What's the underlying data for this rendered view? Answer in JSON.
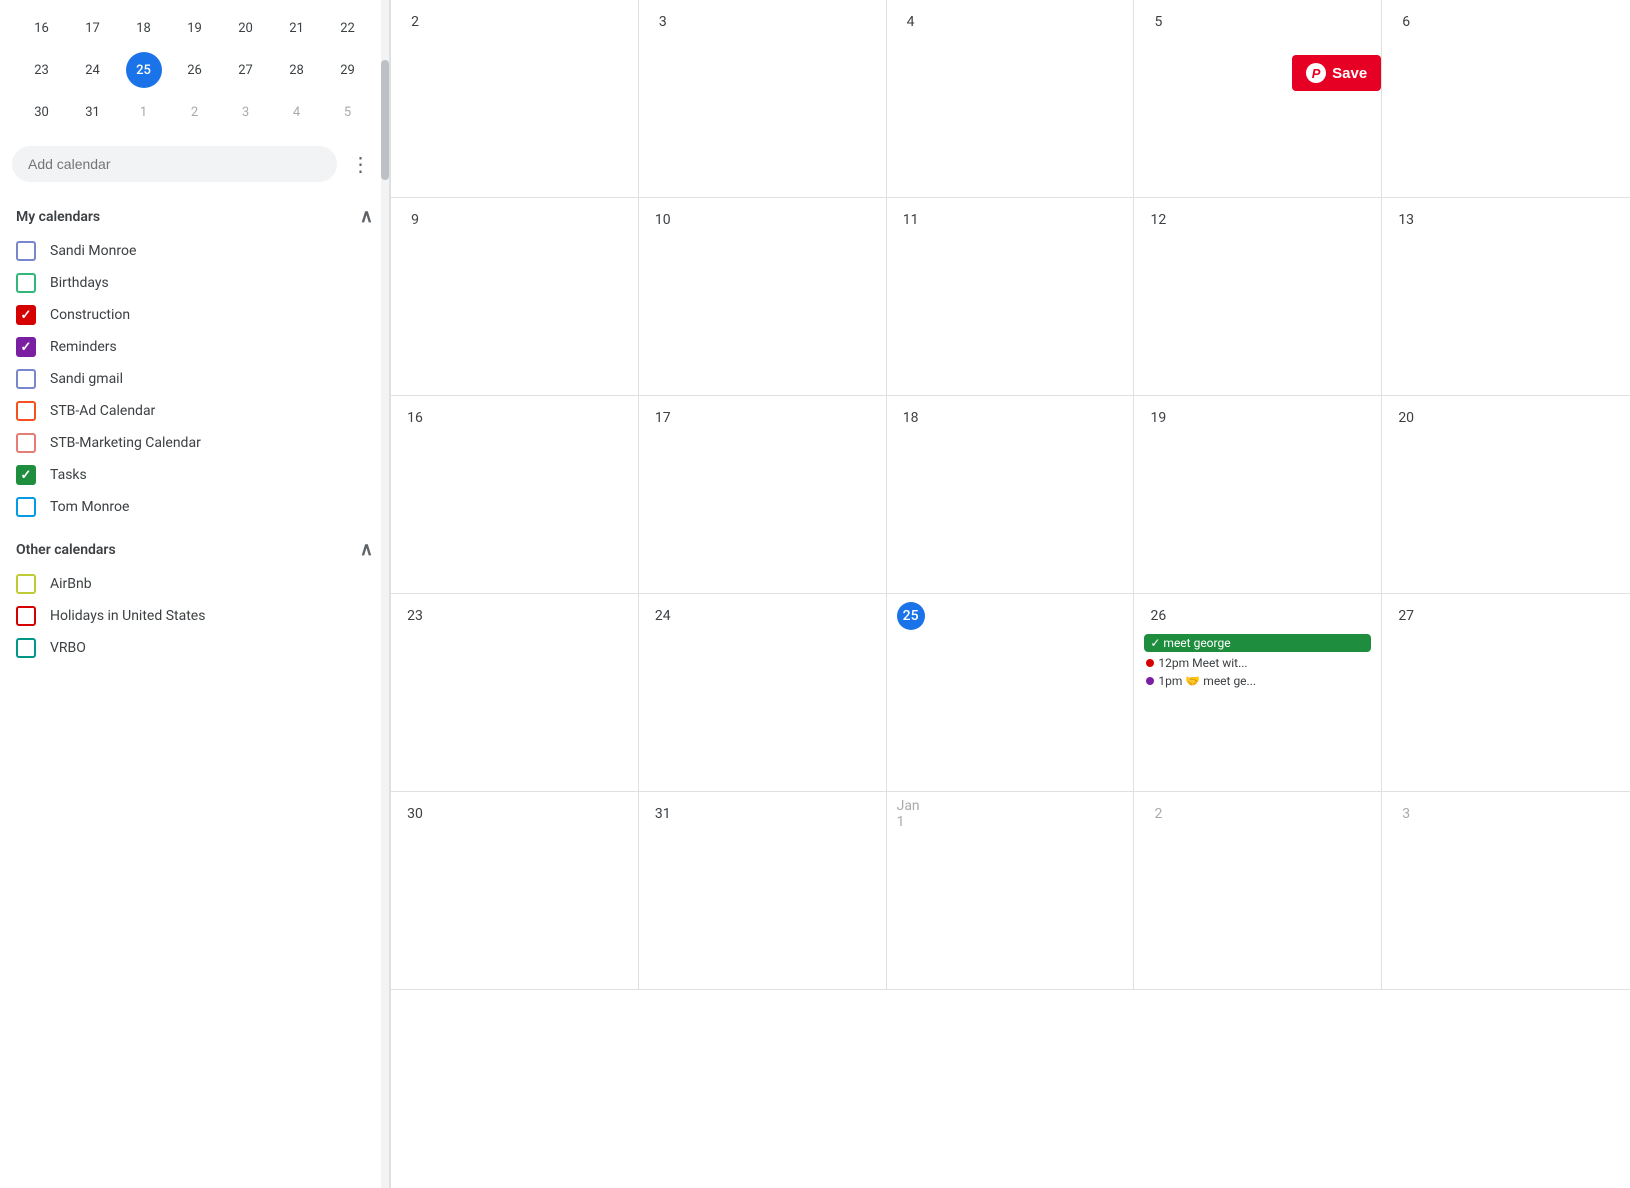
{
  "sidebar": {
    "mini_cal": {
      "rows": [
        [
          {
            "label": "16",
            "type": "normal"
          },
          {
            "label": "17",
            "type": "normal"
          },
          {
            "label": "18",
            "type": "normal"
          },
          {
            "label": "19",
            "type": "normal"
          },
          {
            "label": "20",
            "type": "normal"
          },
          {
            "label": "21",
            "type": "normal"
          },
          {
            "label": "22",
            "type": "normal"
          }
        ],
        [
          {
            "label": "23",
            "type": "normal"
          },
          {
            "label": "24",
            "type": "normal"
          },
          {
            "label": "25",
            "type": "today"
          },
          {
            "label": "26",
            "type": "normal"
          },
          {
            "label": "27",
            "type": "normal"
          },
          {
            "label": "28",
            "type": "normal"
          },
          {
            "label": "29",
            "type": "normal"
          }
        ],
        [
          {
            "label": "30",
            "type": "normal"
          },
          {
            "label": "31",
            "type": "normal"
          },
          {
            "label": "1",
            "type": "other-month"
          },
          {
            "label": "2",
            "type": "other-month"
          },
          {
            "label": "3",
            "type": "other-month"
          },
          {
            "label": "4",
            "type": "other-month"
          },
          {
            "label": "5",
            "type": "other-month"
          }
        ]
      ]
    },
    "add_calendar_placeholder": "Add calendar",
    "my_calendars_label": "My calendars",
    "other_calendars_label": "Other calendars",
    "my_calendars": [
      {
        "label": "Sandi Monroe",
        "color": "#7986cb",
        "checked": false
      },
      {
        "label": "Birthdays",
        "color": "#33b679",
        "checked": false
      },
      {
        "label": "Construction",
        "color": "#d50000",
        "checked": true
      },
      {
        "label": "Reminders",
        "color": "#7b1fa2",
        "checked": true
      },
      {
        "label": "Sandi gmail",
        "color": "#7986cb",
        "checked": false
      },
      {
        "label": "STB-Ad Calendar",
        "color": "#f4511e",
        "checked": false
      },
      {
        "label": "STB-Marketing Calendar",
        "color": "#e67c73",
        "checked": false
      },
      {
        "label": "Tasks",
        "color": "#1e8e3e",
        "checked": true
      },
      {
        "label": "Tom Monroe",
        "color": "#039be5",
        "checked": false
      }
    ],
    "other_calendars": [
      {
        "label": "AirBnb",
        "color": "#c0ca33",
        "checked": false
      },
      {
        "label": "Holidays in United States",
        "color": "#d50000",
        "checked": false
      },
      {
        "label": "VRBO",
        "color": "#009688",
        "checked": false
      }
    ]
  },
  "calendar": {
    "weeks": [
      {
        "days": [
          {
            "number": "2",
            "type": "normal",
            "events": []
          },
          {
            "number": "3",
            "type": "normal",
            "events": []
          },
          {
            "number": "4",
            "type": "normal",
            "events": []
          },
          {
            "number": "5",
            "type": "normal",
            "events": [],
            "has_pinterest": true
          },
          {
            "number": "6",
            "type": "normal",
            "events": []
          }
        ]
      },
      {
        "days": [
          {
            "number": "9",
            "type": "normal",
            "events": []
          },
          {
            "number": "10",
            "type": "normal",
            "events": []
          },
          {
            "number": "11",
            "type": "normal",
            "events": []
          },
          {
            "number": "12",
            "type": "normal",
            "events": []
          },
          {
            "number": "13",
            "type": "normal",
            "events": []
          }
        ]
      },
      {
        "days": [
          {
            "number": "16",
            "type": "normal",
            "events": []
          },
          {
            "number": "17",
            "type": "normal",
            "events": []
          },
          {
            "number": "18",
            "type": "normal",
            "events": []
          },
          {
            "number": "19",
            "type": "normal",
            "events": []
          },
          {
            "number": "20",
            "type": "normal",
            "events": []
          }
        ]
      },
      {
        "days": [
          {
            "number": "23",
            "type": "normal",
            "events": []
          },
          {
            "number": "24",
            "type": "normal",
            "events": []
          },
          {
            "number": "25",
            "type": "today",
            "events": []
          },
          {
            "number": "26",
            "type": "normal",
            "events": [
              {
                "type": "chip",
                "color": "#1e8e3e",
                "bg": "#1e8e3e",
                "text": "✓ meet george",
                "text_color": "#fff"
              },
              {
                "type": "dot",
                "dot_color": "#d50000",
                "text": "12pm Meet wit...",
                "text_color": "#3c4043"
              },
              {
                "type": "dot",
                "dot_color": "#7b1fa2",
                "text": "1pm 🤝 meet ge...",
                "text_color": "#3c4043"
              }
            ]
          },
          {
            "number": "27",
            "type": "normal",
            "events": []
          }
        ]
      },
      {
        "days": [
          {
            "number": "30",
            "type": "normal",
            "events": []
          },
          {
            "number": "31",
            "type": "normal",
            "events": []
          },
          {
            "number": "Jan 1",
            "type": "other-month",
            "events": []
          },
          {
            "number": "2",
            "type": "other-month",
            "events": []
          },
          {
            "number": "3",
            "type": "other-month",
            "events": []
          }
        ]
      }
    ],
    "pinterest_button_label": "Save",
    "pinterest_icon": "P"
  }
}
